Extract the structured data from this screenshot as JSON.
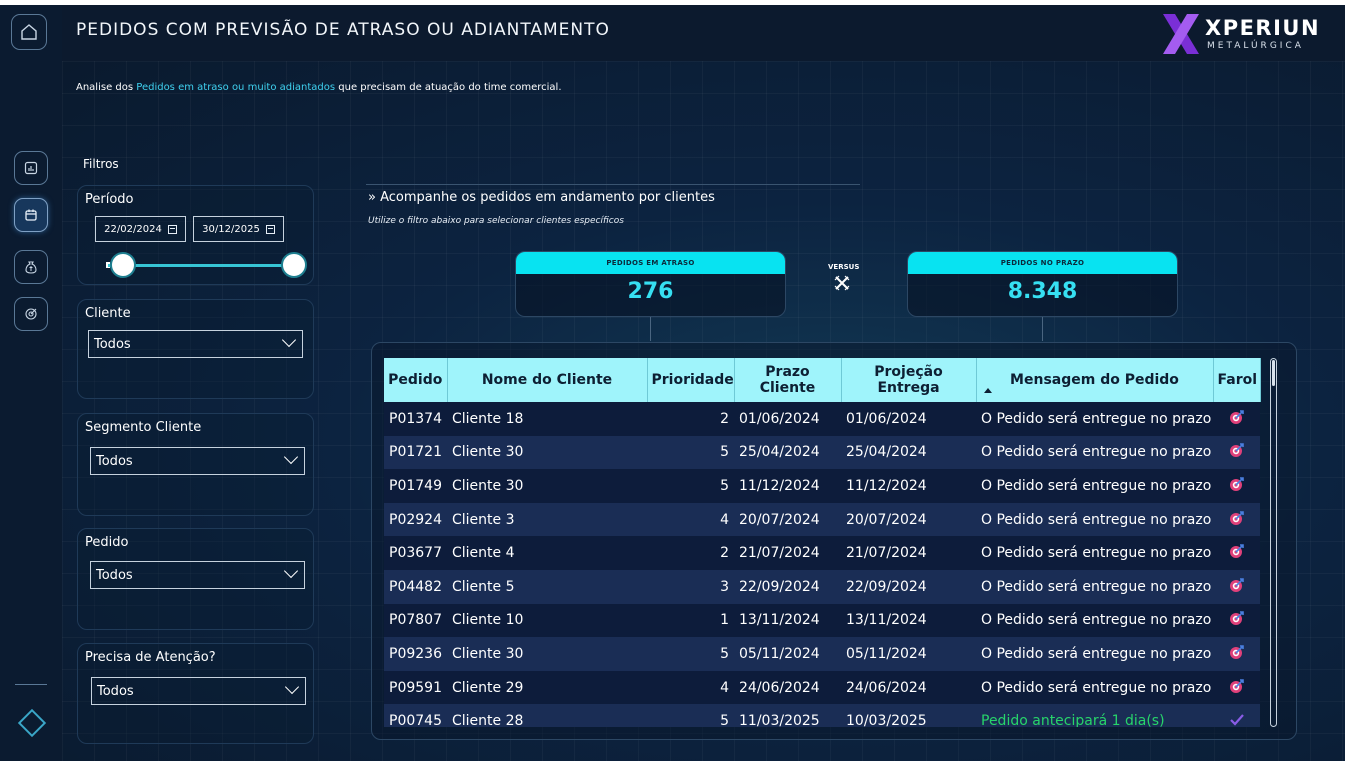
{
  "header": {
    "title": "PEDIDOS COM PREVISÃO DE ATRASO OU ADIANTAMENTO",
    "logo_word": "XPERIUN",
    "logo_sub": "METALÚRGICA"
  },
  "subtitle": {
    "prefix": "Analise dos ",
    "highlight": "Pedidos em atraso ou muito adiantados",
    "suffix": " que precisam de atuação do time comercial."
  },
  "filters": {
    "heading": "Filtros",
    "period": {
      "label": "Período",
      "start": "22/02/2024",
      "end": "30/12/2025"
    },
    "cliente": {
      "label": "Cliente",
      "value": "Todos"
    },
    "segmento": {
      "label": "Segmento Cliente",
      "value": "Todos"
    },
    "pedido": {
      "label": "Pedido",
      "value": "Todos"
    },
    "atencao": {
      "label": "Precisa de Atenção?",
      "value": "Todos"
    }
  },
  "section": {
    "heading": "» Acompanhe os pedidos em andamento por clientes",
    "sub": "Utilize o filtro abaixo para selecionar clientes específicos"
  },
  "kpis": {
    "late": {
      "label": "PEDIDOS EM ATRASO",
      "value": "276"
    },
    "versus": "VERSUS",
    "ontime": {
      "label": "PEDIDOS NO PRAZO",
      "value": "8.348"
    }
  },
  "table": {
    "columns": [
      "Pedido",
      "Nome do Cliente",
      "Prioridade",
      "Prazo Cliente",
      "Projeção Entrega",
      "Mensagem do Pedido",
      "Farol"
    ],
    "rows": [
      [
        "P01374",
        "Cliente 18",
        "2",
        "01/06/2024",
        "01/06/2024",
        "O Pedido será entregue no prazo"
      ],
      [
        "P01721",
        "Cliente 30",
        "5",
        "25/04/2024",
        "25/04/2024",
        "O Pedido será entregue no prazo"
      ],
      [
        "P01749",
        "Cliente 30",
        "5",
        "11/12/2024",
        "11/12/2024",
        "O Pedido será entregue no prazo"
      ],
      [
        "P02924",
        "Cliente 3",
        "4",
        "20/07/2024",
        "20/07/2024",
        "O Pedido será entregue no prazo"
      ],
      [
        "P03677",
        "Cliente 4",
        "2",
        "21/07/2024",
        "21/07/2024",
        "O Pedido será entregue no prazo"
      ],
      [
        "P04482",
        "Cliente 5",
        "3",
        "22/09/2024",
        "22/09/2024",
        "O Pedido será entregue no prazo"
      ],
      [
        "P07807",
        "Cliente 10",
        "1",
        "13/11/2024",
        "13/11/2024",
        "O Pedido será entregue no prazo"
      ],
      [
        "P09236",
        "Cliente 30",
        "5",
        "05/11/2024",
        "05/11/2024",
        "O Pedido será entregue no prazo"
      ],
      [
        "P09591",
        "Cliente 29",
        "4",
        "24/06/2024",
        "24/06/2024",
        "O Pedido será entregue no prazo"
      ],
      [
        "P00745",
        "Cliente 28",
        "5",
        "11/03/2025",
        "10/03/2025",
        "Pedido antecipará 1 dia(s)"
      ]
    ],
    "row_status": [
      "target",
      "target",
      "target",
      "target",
      "target",
      "target",
      "target",
      "target",
      "target",
      "check"
    ]
  },
  "colors": {
    "accent": "#08e3f1",
    "kpi_value": "#36e0f2",
    "header_row": "#9ff4fb",
    "row_odd": "#0d1c3b",
    "row_even": "#1a2d55",
    "ahead_text": "#27d46a",
    "farol_target": "#e0407a",
    "farol_check": "#8a5ce6"
  },
  "icons": {
    "sidebar": [
      "home-icon",
      "chart-icon",
      "calendar-icon",
      "money-bag-icon",
      "target-icon"
    ],
    "farol_target": "target-arrow-icon",
    "farol_check": "check-icon"
  }
}
